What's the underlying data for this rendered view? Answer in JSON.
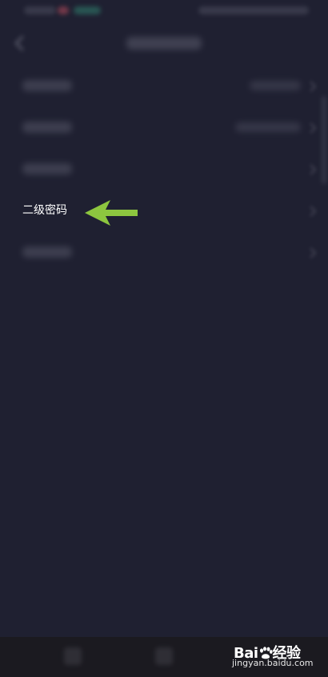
{
  "settings": {
    "rows": [
      {
        "label": ""
      },
      {
        "label": ""
      },
      {
        "label": ""
      },
      {
        "label": "二级密码"
      },
      {
        "label": ""
      }
    ]
  },
  "annotation": {
    "arrow_color": "#8dc63f"
  },
  "watermark": {
    "brand_prefix": "Bai",
    "brand_suffix": "经验",
    "url": "jingyan.baidu.com"
  },
  "icons": {
    "back": "back-arrow-icon",
    "chevron": "chevron-right-icon",
    "pointer": "left-arrow-icon",
    "brand": "paw-icon"
  },
  "colors": {
    "background": "#1f2031",
    "nav_bar": "#1b1a20",
    "label_text": "#ffffff"
  }
}
